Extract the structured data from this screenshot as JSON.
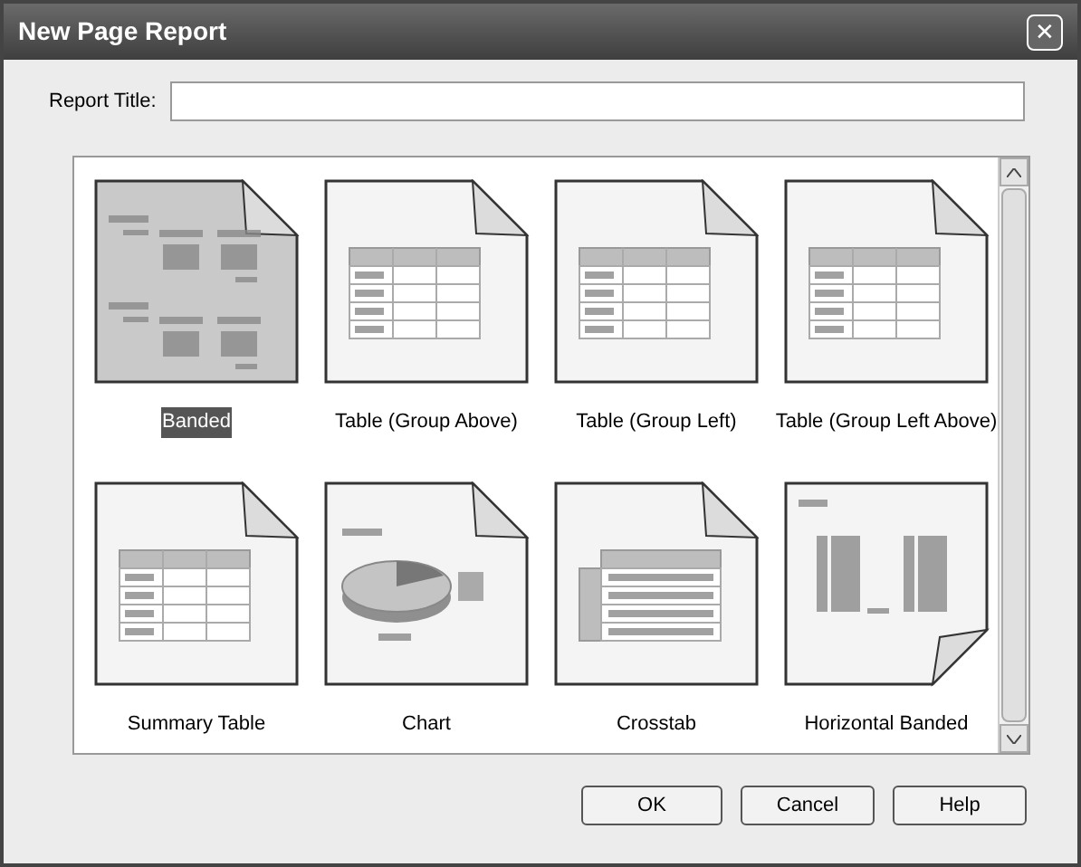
{
  "window": {
    "title": "New Page Report",
    "close": "✕"
  },
  "report_title": {
    "label": "Report Title:"
  },
  "templates": [
    {
      "label": "Banded",
      "kind": "banded",
      "selected": true
    },
    {
      "label": "Table (Group Above)",
      "kind": "table",
      "selected": false
    },
    {
      "label": "Table (Group Left)",
      "kind": "table",
      "selected": false
    },
    {
      "label": "Table (Group Left Above)",
      "kind": "table",
      "selected": false
    },
    {
      "label": "Summary Table",
      "kind": "table",
      "selected": false
    },
    {
      "label": "Chart",
      "kind": "chart",
      "selected": false
    },
    {
      "label": "Crosstab",
      "kind": "crosstab",
      "selected": false
    },
    {
      "label": "Horizontal Banded",
      "kind": "horizontal",
      "selected": false
    }
  ],
  "buttons": [
    "OK",
    "Cancel",
    "Help"
  ]
}
